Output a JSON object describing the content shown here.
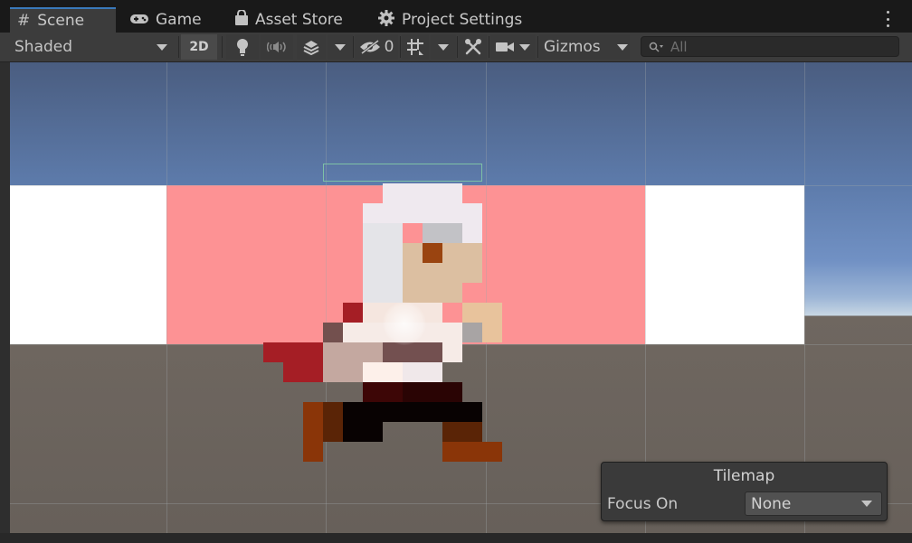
{
  "tabs": [
    {
      "label": "Scene",
      "icon": "hash-icon",
      "active": true
    },
    {
      "label": "Game",
      "icon": "gamepad-icon"
    },
    {
      "label": "Asset Store",
      "icon": "bag-icon"
    },
    {
      "label": "Project Settings",
      "icon": "gear-icon"
    }
  ],
  "toolbar": {
    "draw_mode": "Shaded",
    "mode_2d": "2D",
    "hidden_count": "0",
    "gizmos": "Gizmos",
    "search_placeholder": "All"
  },
  "tilemap_overlay": {
    "title": "Tilemap",
    "focus_label": "Focus On",
    "focus_value": "None"
  },
  "colors": {
    "accent": "#3a79bb",
    "band_pink": "#fd9294",
    "selection": "#7ec1a6"
  }
}
